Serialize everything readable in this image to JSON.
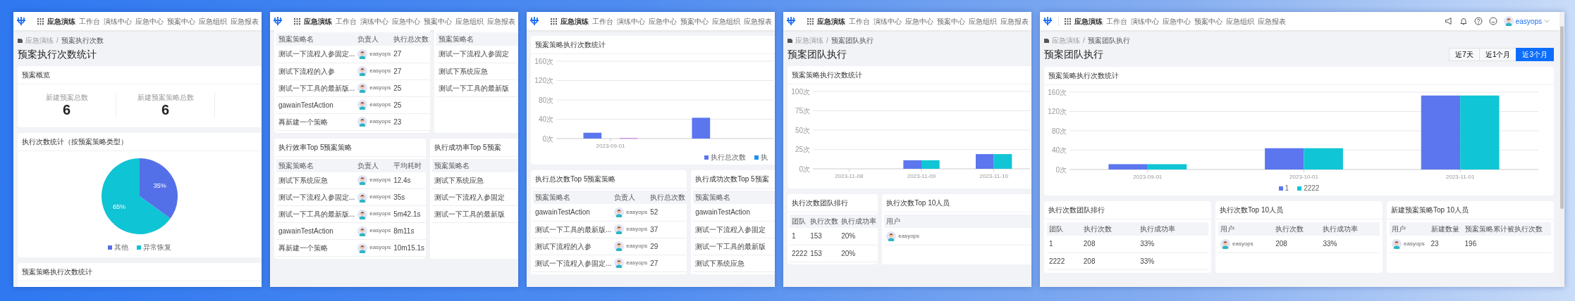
{
  "panels": [
    {
      "cropped": true,
      "nav": {
        "app_name": "应急演练",
        "items": [
          "工作台",
          "演练中心",
          "应急中心",
          "预案中心",
          "应急组织",
          "应急报表"
        ]
      },
      "breadcrumb": {
        "items": [
          "应急演练",
          "预案执行次数"
        ],
        "separator": "/"
      },
      "page_title": "预案执行次数统计",
      "blocks": [
        {
          "kind": "stats",
          "title": "预案概览",
          "stats": [
            {
              "label": "新建预案总数",
              "value": "6"
            },
            {
              "label": "新建预案策略总数",
              "value": "6"
            }
          ]
        },
        {
          "kind": "chart",
          "title": "执行次数统计（按预案策略类型）",
          "chart_data": {
            "type": "pie",
            "categories": [
              "其他",
              "异常恢复"
            ],
            "values": [
              35,
              65
            ],
            "value_labels": [
              "35%",
              "65%"
            ],
            "legend": "bottom"
          }
        },
        {
          "kind": "stub",
          "title": "预案策略执行次数统计"
        }
      ]
    },
    {
      "cropped": true,
      "nav": {
        "app_name": "应急演练",
        "items": [
          "工作台",
          "演练中心",
          "应急中心",
          "预案中心",
          "应急组织",
          "应急报表"
        ]
      },
      "blocks": [
        {
          "kind": "row",
          "cards": [
            {
              "kind": "table",
              "columns": [
                {
                  "label": "预案策略名",
                  "kind": "text"
                },
                {
                  "label": "负责人",
                  "kind": "user"
                },
                {
                  "label": "执行总次数",
                  "kind": "text"
                }
              ],
              "rows": [
                [
                  "测试一下流程入参固定...",
                  "easyops",
                  "27"
                ],
                [
                  "测试下流程的入参",
                  "easyops",
                  "27"
                ],
                [
                  "测试一下工具的最新版...",
                  "easyops",
                  "25"
                ],
                [
                  "gawainTestAction",
                  "easyops",
                  "25"
                ],
                [
                  "再新建一个策略",
                  "easyops",
                  "23"
                ]
              ]
            },
            {
              "kind": "table",
              "columns": [
                {
                  "label": "预案策略名",
                  "kind": "text"
                }
              ],
              "rows": [
                [
                  "测试一下流程入参固定"
                ],
                [
                  "测试下系统应急"
                ],
                [
                  "测试一下工具的最新版"
                ]
              ]
            }
          ]
        },
        {
          "kind": "row",
          "cards": [
            {
              "kind": "table",
              "title": "执行效率Top 5预案策略",
              "columns": [
                {
                  "label": "预案策略名",
                  "kind": "text"
                },
                {
                  "label": "负责人",
                  "kind": "user"
                },
                {
                  "label": "平均耗时",
                  "kind": "text"
                }
              ],
              "rows": [
                [
                  "测试下系统应急",
                  "easyops",
                  "12.4s"
                ],
                [
                  "测试一下流程入参固定...",
                  "easyops",
                  "35s"
                ],
                [
                  "测试一下工具的最新版...",
                  "easyops",
                  "5m42.1s"
                ],
                [
                  "gawainTestAction",
                  "easyops",
                  "8m11s"
                ],
                [
                  "再新建一个策略",
                  "easyops",
                  "10m15.1s"
                ]
              ]
            },
            {
              "kind": "table",
              "title": "执行成功率Top 5预案",
              "columns": [
                {
                  "label": "预案策略名",
                  "kind": "text"
                }
              ],
              "rows": [
                [
                  "测试下系统应急"
                ],
                [
                  "测试一下流程入参固定"
                ],
                [
                  "测试一下工具的最新版"
                ]
              ]
            }
          ]
        }
      ]
    },
    {
      "cropped": true,
      "nav": {
        "app_name": "应急演练",
        "items": [
          "工作台",
          "演练中心",
          "应急中心",
          "预案中心",
          "应急组织",
          "应急报表"
        ]
      },
      "blocks": [
        {
          "kind": "chart",
          "title": "预案策略执行次数统计",
          "chart_data": {
            "type": "bar",
            "categories": [
              "2023-09-01",
              null
            ],
            "grid": true,
            "legend": "bottom-right",
            "series": [
              {
                "name": "执行总次数",
                "color": "#5b76ee",
                "values": [
                  12,
                  43
                ]
              },
              {
                "name": "执",
                "color": "#1f8ef1",
                "values": [
                  0,
                  null
                ]
              },
              {
                "color": "#c47cf0",
                "values": [
                  1,
                  null
                ]
              }
            ],
            "ylim": [
              0,
              160
            ],
            "yticks": [
              {
                "value": 0,
                "label": "0次"
              },
              {
                "value": 40,
                "label": "40次"
              },
              {
                "value": 80,
                "label": "80次"
              },
              {
                "value": 120,
                "label": "120次"
              },
              {
                "value": 160,
                "label": "160次"
              }
            ]
          }
        },
        {
          "kind": "row",
          "cards": [
            {
              "kind": "table",
              "title": "执行总次数Top 5预案策略",
              "columns": [
                {
                  "label": "预案策略名",
                  "kind": "text"
                },
                {
                  "label": "负责人",
                  "kind": "user"
                },
                {
                  "label": "执行总次数",
                  "kind": "text"
                }
              ],
              "rows": [
                [
                  "gawainTestAction",
                  "easyops",
                  "52"
                ],
                [
                  "测试一下工具的最新版...",
                  "easyops",
                  "37"
                ],
                [
                  "测试下流程的入参",
                  "easyops",
                  "29"
                ],
                [
                  "测试一下流程入参固定...",
                  "easyops",
                  "27"
                ]
              ]
            },
            {
              "kind": "table",
              "title": "执行成功次数Top 5预案",
              "columns": [
                {
                  "label": "预案策略名",
                  "kind": "text"
                }
              ],
              "rows": [
                [
                  "gawainTestAction"
                ],
                [
                  "测试一下流程入参固定"
                ],
                [
                  "测试一下工具的最新版"
                ],
                [
                  "测试下系统应急"
                ]
              ]
            }
          ]
        }
      ]
    },
    {
      "cropped": true,
      "nav": {
        "app_name": "应急演练",
        "items": [
          "工作台",
          "演练中心",
          "应急中心",
          "预案中心",
          "应急组织",
          "应急报表"
        ]
      },
      "breadcrumb": {
        "items": [
          "应急演练",
          "预案团队执行"
        ],
        "separator": "/"
      },
      "page_title": "预案团队执行",
      "blocks": [
        {
          "kind": "chart",
          "title": "预案策略执行次数统计",
          "chart_data": {
            "type": "bar",
            "categories": [
              "2023-11-08",
              "2023-11-09",
              "2023-11-10"
            ],
            "grid": true,
            "series": [
              {
                "color": "#5b76ee",
                "values": [
                  0,
                  11,
                  19
                ]
              },
              {
                "color": "#10c6d6",
                "values": [
                  0,
                  11,
                  19
                ]
              }
            ],
            "ylim": [
              0,
              100
            ],
            "yticks": [
              {
                "value": 0,
                "label": "0次"
              },
              {
                "value": 25,
                "label": "25次"
              },
              {
                "value": 50,
                "label": "50次"
              },
              {
                "value": 75,
                "label": "75次"
              },
              {
                "value": 100,
                "label": "100次"
              }
            ]
          }
        },
        {
          "kind": "row",
          "cards": [
            {
              "kind": "table",
              "title": "执行次数团队排行",
              "columns": [
                {
                  "label": "团队",
                  "kind": "text"
                },
                {
                  "label": "执行次数",
                  "kind": "text"
                },
                {
                  "label": "执行成功率",
                  "kind": "text"
                }
              ],
              "rows": [
                [
                  "1",
                  "153",
                  "20%"
                ],
                [
                  "2222",
                  "153",
                  "20%"
                ]
              ]
            },
            {
              "kind": "table",
              "title": "执行次数Top 10人员",
              "columns": [
                {
                  "label": "用户",
                  "kind": "user"
                }
              ],
              "rows": [
                [
                  "easyops"
                ]
              ]
            }
          ]
        }
      ]
    },
    {
      "cropped": false,
      "nav": {
        "app_name": "应急演练",
        "items": [
          "工作台",
          "演练中心",
          "应急中心",
          "预案中心",
          "应急组织",
          "应急报表"
        ]
      },
      "user_menu": {
        "name": "easyops"
      },
      "breadcrumb": {
        "items": [
          "应急演练",
          "预案团队执行"
        ],
        "separator": "/"
      },
      "page_title": "预案团队执行",
      "ranges": [
        {
          "label": "近7天",
          "selected": false
        },
        {
          "label": "近1个月",
          "selected": false
        },
        {
          "label": "近3个月",
          "selected": true
        }
      ],
      "blocks": [
        {
          "kind": "chart",
          "title": "预案策略执行次数统计",
          "chart_data": {
            "type": "bar",
            "categories": [
              "2023-09-01",
              "2023-10-01",
              "2023-11-01"
            ],
            "grid": true,
            "legend": "bottom",
            "series": [
              {
                "name": "1",
                "color": "#5b76ee",
                "values": [
                  11,
                  44,
                  153
                ]
              },
              {
                "name": "2222",
                "color": "#10c6d6",
                "values": [
                  11,
                  44,
                  153
                ]
              }
            ],
            "ylim": [
              0,
              160
            ],
            "yticks": [
              {
                "value": 0,
                "label": "0次"
              },
              {
                "value": 40,
                "label": "40次"
              },
              {
                "value": 80,
                "label": "80次"
              },
              {
                "value": 120,
                "label": "120次"
              },
              {
                "value": 160,
                "label": "160次"
              }
            ]
          }
        },
        {
          "kind": "row",
          "cards": [
            {
              "kind": "table",
              "title": "执行次数团队排行",
              "columns": [
                {
                  "label": "团队",
                  "kind": "text"
                },
                {
                  "label": "执行次数",
                  "kind": "text"
                },
                {
                  "label": "执行成功率",
                  "kind": "text"
                }
              ],
              "rows": [
                [
                  "1",
                  "208",
                  "33%"
                ],
                [
                  "2222",
                  "208",
                  "33%"
                ]
              ]
            },
            {
              "kind": "table",
              "title": "执行次数Top 10人员",
              "columns": [
                {
                  "label": "用户",
                  "kind": "user"
                },
                {
                  "label": "执行次数",
                  "kind": "text"
                },
                {
                  "label": "执行成功率",
                  "kind": "text"
                }
              ],
              "rows": [
                [
                  "easyops",
                  "208",
                  "33%"
                ]
              ]
            },
            {
              "kind": "table",
              "title": "新建预案策略Top 10人员",
              "columns": [
                {
                  "label": "用户",
                  "kind": "user"
                },
                {
                  "label": "新建数量",
                  "kind": "text"
                },
                {
                  "label": "预案策略累计被执行次数",
                  "kind": "text"
                }
              ],
              "rows": [
                [
                  "easyops",
                  "23",
                  "196"
                ]
              ]
            }
          ]
        }
      ]
    }
  ]
}
